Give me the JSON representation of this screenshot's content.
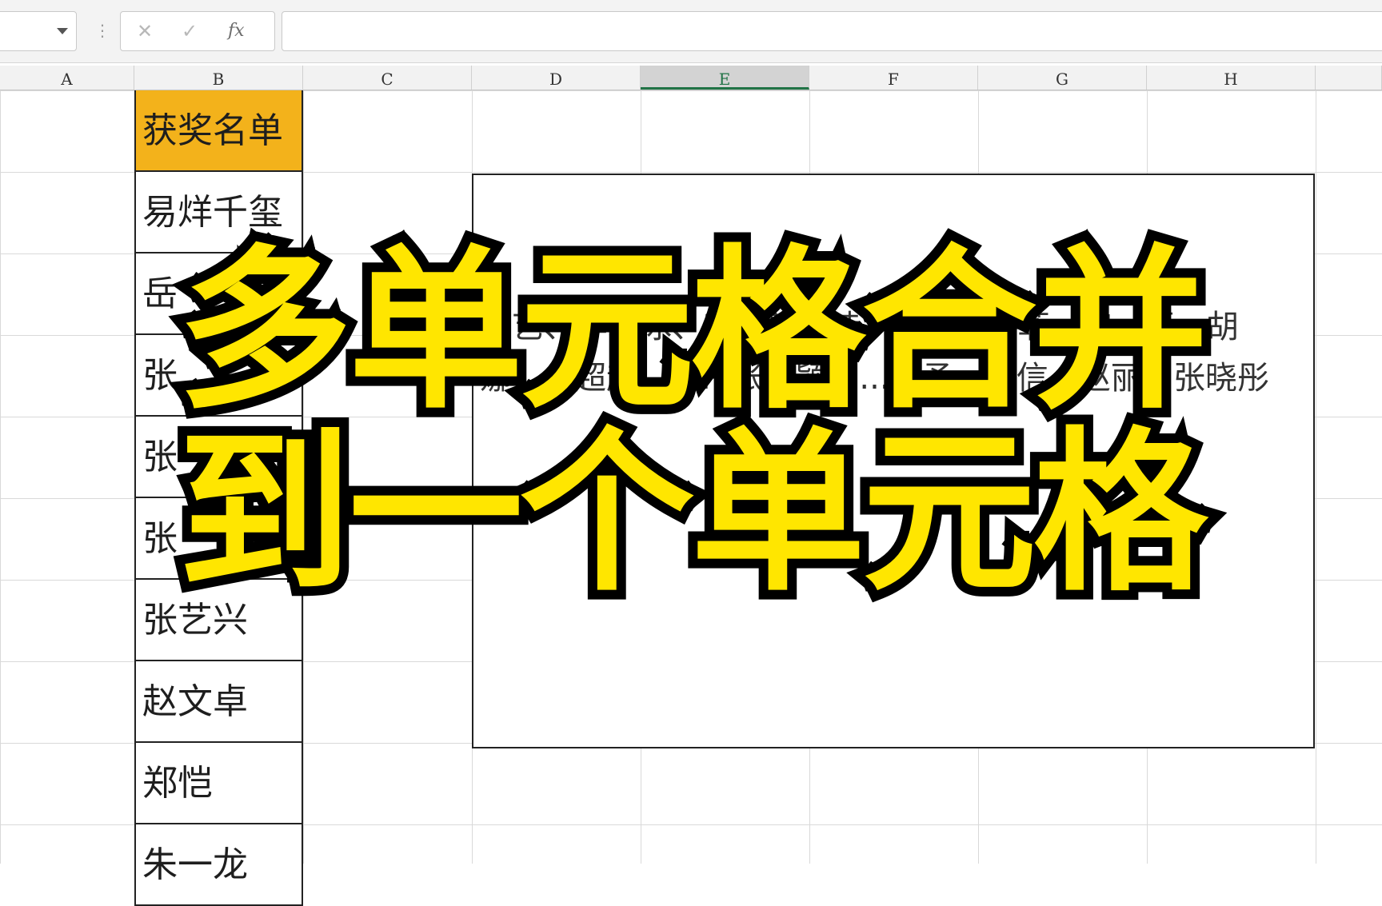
{
  "formula_bar": {
    "name_box_value": "",
    "cancel_icon": "✕",
    "enter_icon": "✓",
    "fx_label": "fx",
    "formula_value": ""
  },
  "columns": [
    "A",
    "B",
    "C",
    "D",
    "E",
    "F",
    "G",
    "H"
  ],
  "active_column": "E",
  "column_b": {
    "header": "获奖名单",
    "names": [
      "易烊千玺",
      "岳",
      "张",
      "张",
      "张",
      "张艺兴",
      "赵文卓",
      "郑恺",
      "朱一龙"
    ]
  },
  "merged_cell_text": "张艺、李冰冰、李...新...诗...刘...刘亦菲...宋...娅、胡娜、...超越...杨...张靓颖、...馨予、...信...赵丽...张晓彤",
  "overlay_title": {
    "line1": "多单元格合并",
    "line2": "到一个单元格"
  },
  "colors": {
    "header_fill": "#f3b21b",
    "title_fill": "#ffe600",
    "title_stroke": "#000000",
    "active_column_accent": "#217346"
  }
}
